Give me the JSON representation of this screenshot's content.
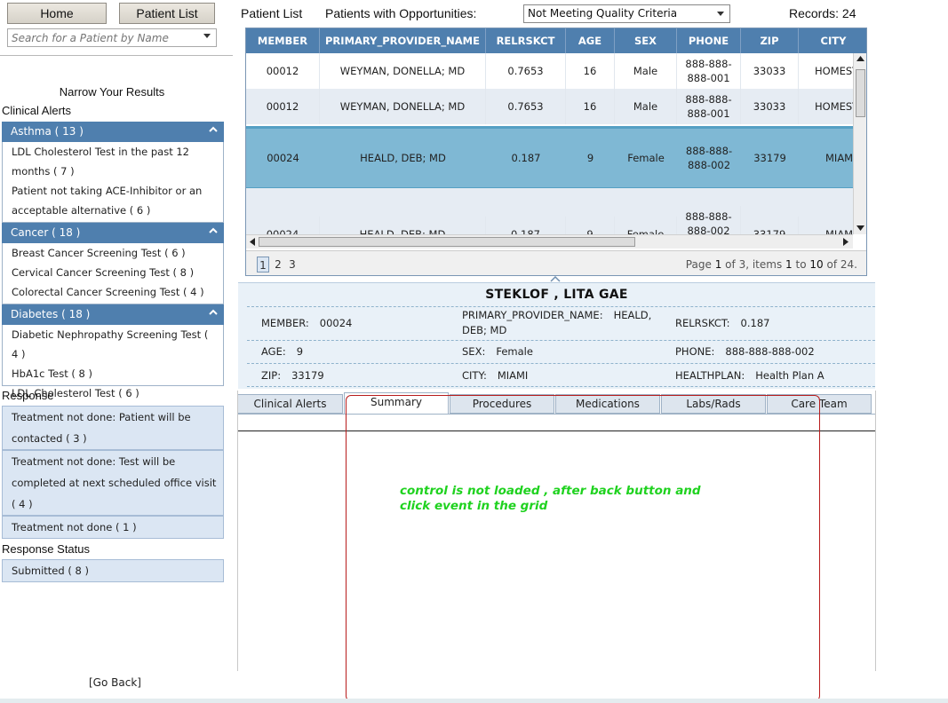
{
  "nav": {
    "home": "Home",
    "patient_list": "Patient List"
  },
  "search": {
    "placeholder": "Search for a Patient by Name"
  },
  "filters": {
    "title": "Narrow Your Results",
    "clinical_alerts_title": "Clinical Alerts",
    "groups": [
      {
        "label": "Asthma ( 13 )",
        "items": [
          "LDL Cholesterol Test in the past 12 months ( 7 )",
          "Patient not taking ACE-Inhibitor or an acceptable alternative ( 6 )"
        ]
      },
      {
        "label": "Cancer ( 18 )",
        "items": [
          "Breast Cancer Screening Test ( 6 )",
          "Cervical Cancer Screening Test ( 8 )",
          "Colorectal Cancer Screening Test ( 4 )"
        ]
      },
      {
        "label": "Diabetes ( 18 )",
        "items": [
          "Diabetic Nephropathy Screening Test ( 4 )",
          "HbA1c Test ( 8 )",
          "LDL Cholesterol Test ( 6 )"
        ]
      }
    ],
    "response_title": "Response",
    "responses": [
      "Treatment not done: Patient will be contacted ( 3 )",
      "Treatment not done: Test will be completed at next scheduled office visit ( 4 )",
      "Treatment not done ( 1 )"
    ],
    "response_status_title": "Response Status",
    "statuses": [
      "Submitted ( 8 )"
    ]
  },
  "go_back": "[Go Back]",
  "header": {
    "patient_list_label": "Patient List",
    "opportunities_label": "Patients with Opportunities:",
    "opportunity_selected": "Not Meeting Quality Criteria",
    "records": "Records: 24"
  },
  "grid": {
    "columns": [
      "MEMBER",
      "PRIMARY_PROVIDER_NAME",
      "RELRSKCT",
      "AGE",
      "SEX",
      "PHONE",
      "ZIP",
      "CITY"
    ],
    "rows": [
      [
        "00012",
        "WEYMAN, DONELLA; MD",
        "0.7653",
        "16",
        "Male",
        "888-888-888-001",
        "33033",
        "HOMESTEAD"
      ],
      [
        "00012",
        "WEYMAN, DONELLA; MD",
        "0.7653",
        "16",
        "Male",
        "888-888-888-001",
        "33033",
        "HOMESTEAD"
      ],
      [
        "00024",
        "HEALD, DEB; MD",
        "0.187",
        "9",
        "Female",
        "888-888-888-002",
        "33179",
        "MIAMI"
      ],
      [
        "00024",
        "HEALD, DEB; MD",
        "0.187",
        "9",
        "Female",
        "888-888-888-002",
        "33179",
        "MIAMI"
      ]
    ]
  },
  "pager": {
    "pages": [
      "1",
      "2",
      "3"
    ],
    "info": {
      "page_word": "Page",
      "page": "1",
      "of_word": "of",
      "total_pages": "3,",
      "items_word": "items",
      "from": "1",
      "to_word": "to",
      "to": "10",
      "of2": "of",
      "total": "24."
    }
  },
  "detail": {
    "name": "STEKLOF , LITA GAE",
    "member_label": "MEMBER:",
    "member": "00024",
    "provider_label": "PRIMARY_PROVIDER_NAME:",
    "provider": "HEALD, DEB; MD",
    "relrskct_label": "RELRSKCT:",
    "relrskct": "0.187",
    "age_label": "AGE:",
    "age": "9",
    "sex_label": "SEX:",
    "sex": "Female",
    "phone_label": "PHONE:",
    "phone": "888-888-888-002",
    "zip_label": "ZIP:",
    "zip": "33179",
    "city_label": "CITY:",
    "city": "MIAMI",
    "healthplan_label": "HEALTHPLAN:",
    "healthplan": "Health Plan A"
  },
  "tabs": [
    "Clinical Alerts",
    "Summary",
    "Procedures",
    "Medications",
    "Labs/Rads",
    "Care Team"
  ],
  "annotation": "control is not loaded , after back button and click event in the grid",
  "colors": {
    "header_blue": "#4f7fae",
    "selected_row": "#7fb8d4",
    "annotation_green": "#1fd21f",
    "annotation_box": "#b81c1c"
  }
}
